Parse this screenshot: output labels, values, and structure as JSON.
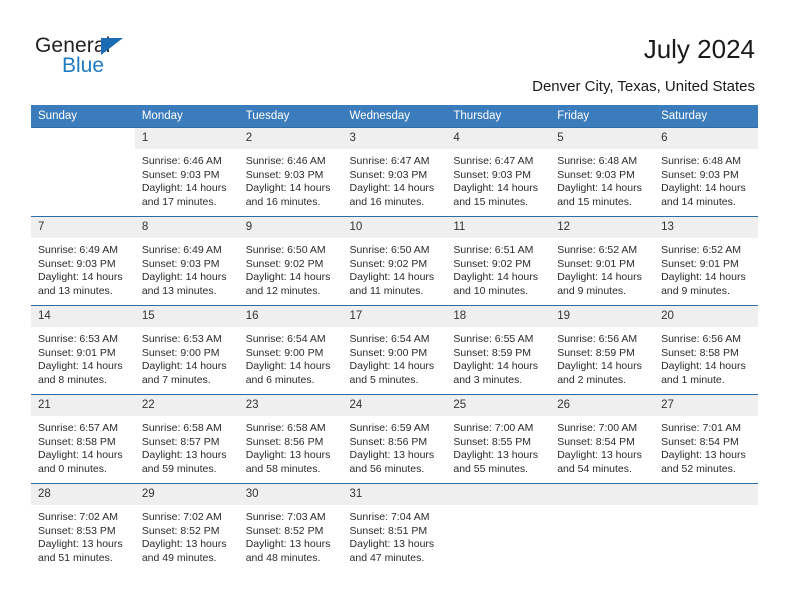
{
  "brand": {
    "name_primary": "General",
    "name_secondary": "Blue",
    "accent_color": "#1f7bc1",
    "triangle_color": "#1c6cb3"
  },
  "header": {
    "title": "July 2024",
    "subtitle": "Denver City, Texas, United States"
  },
  "calendar": {
    "header_bg": "#3b7cbd",
    "daynum_bg": "#efefef",
    "row_border_color": "#2e6da4",
    "weekday_headers": [
      "Sunday",
      "Monday",
      "Tuesday",
      "Wednesday",
      "Thursday",
      "Friday",
      "Saturday"
    ],
    "weeks": [
      [
        {
          "day": "",
          "empty": true
        },
        {
          "day": "1",
          "sunrise": "Sunrise: 6:46 AM",
          "sunset": "Sunset: 9:03 PM",
          "daylight_line1": "Daylight: 14 hours",
          "daylight_line2": "and 17 minutes."
        },
        {
          "day": "2",
          "sunrise": "Sunrise: 6:46 AM",
          "sunset": "Sunset: 9:03 PM",
          "daylight_line1": "Daylight: 14 hours",
          "daylight_line2": "and 16 minutes."
        },
        {
          "day": "3",
          "sunrise": "Sunrise: 6:47 AM",
          "sunset": "Sunset: 9:03 PM",
          "daylight_line1": "Daylight: 14 hours",
          "daylight_line2": "and 16 minutes."
        },
        {
          "day": "4",
          "sunrise": "Sunrise: 6:47 AM",
          "sunset": "Sunset: 9:03 PM",
          "daylight_line1": "Daylight: 14 hours",
          "daylight_line2": "and 15 minutes."
        },
        {
          "day": "5",
          "sunrise": "Sunrise: 6:48 AM",
          "sunset": "Sunset: 9:03 PM",
          "daylight_line1": "Daylight: 14 hours",
          "daylight_line2": "and 15 minutes."
        },
        {
          "day": "6",
          "sunrise": "Sunrise: 6:48 AM",
          "sunset": "Sunset: 9:03 PM",
          "daylight_line1": "Daylight: 14 hours",
          "daylight_line2": "and 14 minutes."
        }
      ],
      [
        {
          "day": "7",
          "sunrise": "Sunrise: 6:49 AM",
          "sunset": "Sunset: 9:03 PM",
          "daylight_line1": "Daylight: 14 hours",
          "daylight_line2": "and 13 minutes."
        },
        {
          "day": "8",
          "sunrise": "Sunrise: 6:49 AM",
          "sunset": "Sunset: 9:03 PM",
          "daylight_line1": "Daylight: 14 hours",
          "daylight_line2": "and 13 minutes."
        },
        {
          "day": "9",
          "sunrise": "Sunrise: 6:50 AM",
          "sunset": "Sunset: 9:02 PM",
          "daylight_line1": "Daylight: 14 hours",
          "daylight_line2": "and 12 minutes."
        },
        {
          "day": "10",
          "sunrise": "Sunrise: 6:50 AM",
          "sunset": "Sunset: 9:02 PM",
          "daylight_line1": "Daylight: 14 hours",
          "daylight_line2": "and 11 minutes."
        },
        {
          "day": "11",
          "sunrise": "Sunrise: 6:51 AM",
          "sunset": "Sunset: 9:02 PM",
          "daylight_line1": "Daylight: 14 hours",
          "daylight_line2": "and 10 minutes."
        },
        {
          "day": "12",
          "sunrise": "Sunrise: 6:52 AM",
          "sunset": "Sunset: 9:01 PM",
          "daylight_line1": "Daylight: 14 hours",
          "daylight_line2": "and 9 minutes."
        },
        {
          "day": "13",
          "sunrise": "Sunrise: 6:52 AM",
          "sunset": "Sunset: 9:01 PM",
          "daylight_line1": "Daylight: 14 hours",
          "daylight_line2": "and 9 minutes."
        }
      ],
      [
        {
          "day": "14",
          "sunrise": "Sunrise: 6:53 AM",
          "sunset": "Sunset: 9:01 PM",
          "daylight_line1": "Daylight: 14 hours",
          "daylight_line2": "and 8 minutes."
        },
        {
          "day": "15",
          "sunrise": "Sunrise: 6:53 AM",
          "sunset": "Sunset: 9:00 PM",
          "daylight_line1": "Daylight: 14 hours",
          "daylight_line2": "and 7 minutes."
        },
        {
          "day": "16",
          "sunrise": "Sunrise: 6:54 AM",
          "sunset": "Sunset: 9:00 PM",
          "daylight_line1": "Daylight: 14 hours",
          "daylight_line2": "and 6 minutes."
        },
        {
          "day": "17",
          "sunrise": "Sunrise: 6:54 AM",
          "sunset": "Sunset: 9:00 PM",
          "daylight_line1": "Daylight: 14 hours",
          "daylight_line2": "and 5 minutes."
        },
        {
          "day": "18",
          "sunrise": "Sunrise: 6:55 AM",
          "sunset": "Sunset: 8:59 PM",
          "daylight_line1": "Daylight: 14 hours",
          "daylight_line2": "and 3 minutes."
        },
        {
          "day": "19",
          "sunrise": "Sunrise: 6:56 AM",
          "sunset": "Sunset: 8:59 PM",
          "daylight_line1": "Daylight: 14 hours",
          "daylight_line2": "and 2 minutes."
        },
        {
          "day": "20",
          "sunrise": "Sunrise: 6:56 AM",
          "sunset": "Sunset: 8:58 PM",
          "daylight_line1": "Daylight: 14 hours",
          "daylight_line2": "and 1 minute."
        }
      ],
      [
        {
          "day": "21",
          "sunrise": "Sunrise: 6:57 AM",
          "sunset": "Sunset: 8:58 PM",
          "daylight_line1": "Daylight: 14 hours",
          "daylight_line2": "and 0 minutes."
        },
        {
          "day": "22",
          "sunrise": "Sunrise: 6:58 AM",
          "sunset": "Sunset: 8:57 PM",
          "daylight_line1": "Daylight: 13 hours",
          "daylight_line2": "and 59 minutes."
        },
        {
          "day": "23",
          "sunrise": "Sunrise: 6:58 AM",
          "sunset": "Sunset: 8:56 PM",
          "daylight_line1": "Daylight: 13 hours",
          "daylight_line2": "and 58 minutes."
        },
        {
          "day": "24",
          "sunrise": "Sunrise: 6:59 AM",
          "sunset": "Sunset: 8:56 PM",
          "daylight_line1": "Daylight: 13 hours",
          "daylight_line2": "and 56 minutes."
        },
        {
          "day": "25",
          "sunrise": "Sunrise: 7:00 AM",
          "sunset": "Sunset: 8:55 PM",
          "daylight_line1": "Daylight: 13 hours",
          "daylight_line2": "and 55 minutes."
        },
        {
          "day": "26",
          "sunrise": "Sunrise: 7:00 AM",
          "sunset": "Sunset: 8:54 PM",
          "daylight_line1": "Daylight: 13 hours",
          "daylight_line2": "and 54 minutes."
        },
        {
          "day": "27",
          "sunrise": "Sunrise: 7:01 AM",
          "sunset": "Sunset: 8:54 PM",
          "daylight_line1": "Daylight: 13 hours",
          "daylight_line2": "and 52 minutes."
        }
      ],
      [
        {
          "day": "28",
          "sunrise": "Sunrise: 7:02 AM",
          "sunset": "Sunset: 8:53 PM",
          "daylight_line1": "Daylight: 13 hours",
          "daylight_line2": "and 51 minutes."
        },
        {
          "day": "29",
          "sunrise": "Sunrise: 7:02 AM",
          "sunset": "Sunset: 8:52 PM",
          "daylight_line1": "Daylight: 13 hours",
          "daylight_line2": "and 49 minutes."
        },
        {
          "day": "30",
          "sunrise": "Sunrise: 7:03 AM",
          "sunset": "Sunset: 8:52 PM",
          "daylight_line1": "Daylight: 13 hours",
          "daylight_line2": "and 48 minutes."
        },
        {
          "day": "31",
          "sunrise": "Sunrise: 7:04 AM",
          "sunset": "Sunset: 8:51 PM",
          "daylight_line1": "Daylight: 13 hours",
          "daylight_line2": "and 47 minutes."
        },
        {
          "day": "",
          "empty": true,
          "blank_band": true
        },
        {
          "day": "",
          "empty": true,
          "blank_band": true
        },
        {
          "day": "",
          "empty": true,
          "blank_band": true
        }
      ]
    ]
  }
}
